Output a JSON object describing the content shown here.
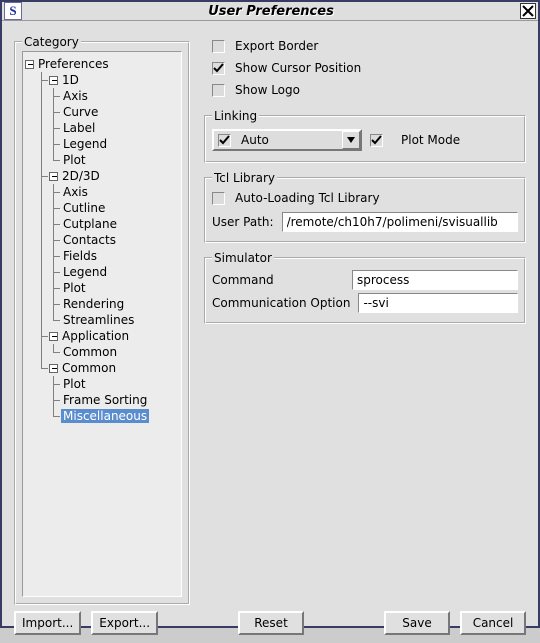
{
  "window": {
    "title": "User Preferences",
    "app_icon_letter": "S"
  },
  "category": {
    "legend": "Category",
    "tree": {
      "label": "Preferences",
      "children": [
        {
          "label": "1D",
          "children": [
            {
              "label": "Axis"
            },
            {
              "label": "Curve"
            },
            {
              "label": "Label"
            },
            {
              "label": "Legend"
            },
            {
              "label": "Plot"
            }
          ]
        },
        {
          "label": "2D/3D",
          "children": [
            {
              "label": "Axis"
            },
            {
              "label": "Cutline"
            },
            {
              "label": "Cutplane"
            },
            {
              "label": "Contacts"
            },
            {
              "label": "Fields"
            },
            {
              "label": "Legend"
            },
            {
              "label": "Plot"
            },
            {
              "label": "Rendering"
            },
            {
              "label": "Streamlines"
            }
          ]
        },
        {
          "label": "Application",
          "children": [
            {
              "label": "Common"
            }
          ]
        },
        {
          "label": "Common",
          "children": [
            {
              "label": "Plot"
            },
            {
              "label": "Frame Sorting"
            },
            {
              "label": "Miscellaneous",
              "selected": true
            }
          ]
        }
      ]
    }
  },
  "topchecks": {
    "export_border": {
      "label": "Export Border",
      "checked": false
    },
    "show_cursor": {
      "label": "Show Cursor Position",
      "checked": true
    },
    "show_logo": {
      "label": "Show Logo",
      "checked": false
    }
  },
  "linking": {
    "legend": "Linking",
    "auto": {
      "label": "Auto",
      "checked": true
    },
    "plot_mode": {
      "label": "Plot Mode",
      "checked": true
    }
  },
  "tcl": {
    "legend": "Tcl Library",
    "autoload": {
      "label": "Auto-Loading Tcl Library",
      "checked": false
    },
    "user_path_label": "User Path:",
    "user_path_value": "/remote/ch10h7/polimeni/svisuallib"
  },
  "simulator": {
    "legend": "Simulator",
    "command_label": "Command",
    "command_value": "sprocess",
    "comm_option_label": "Communication Option",
    "comm_option_value": "--svi"
  },
  "buttons": {
    "import": "Import...",
    "export": "Export...",
    "reset": "Reset",
    "save": "Save",
    "cancel": "Cancel"
  }
}
